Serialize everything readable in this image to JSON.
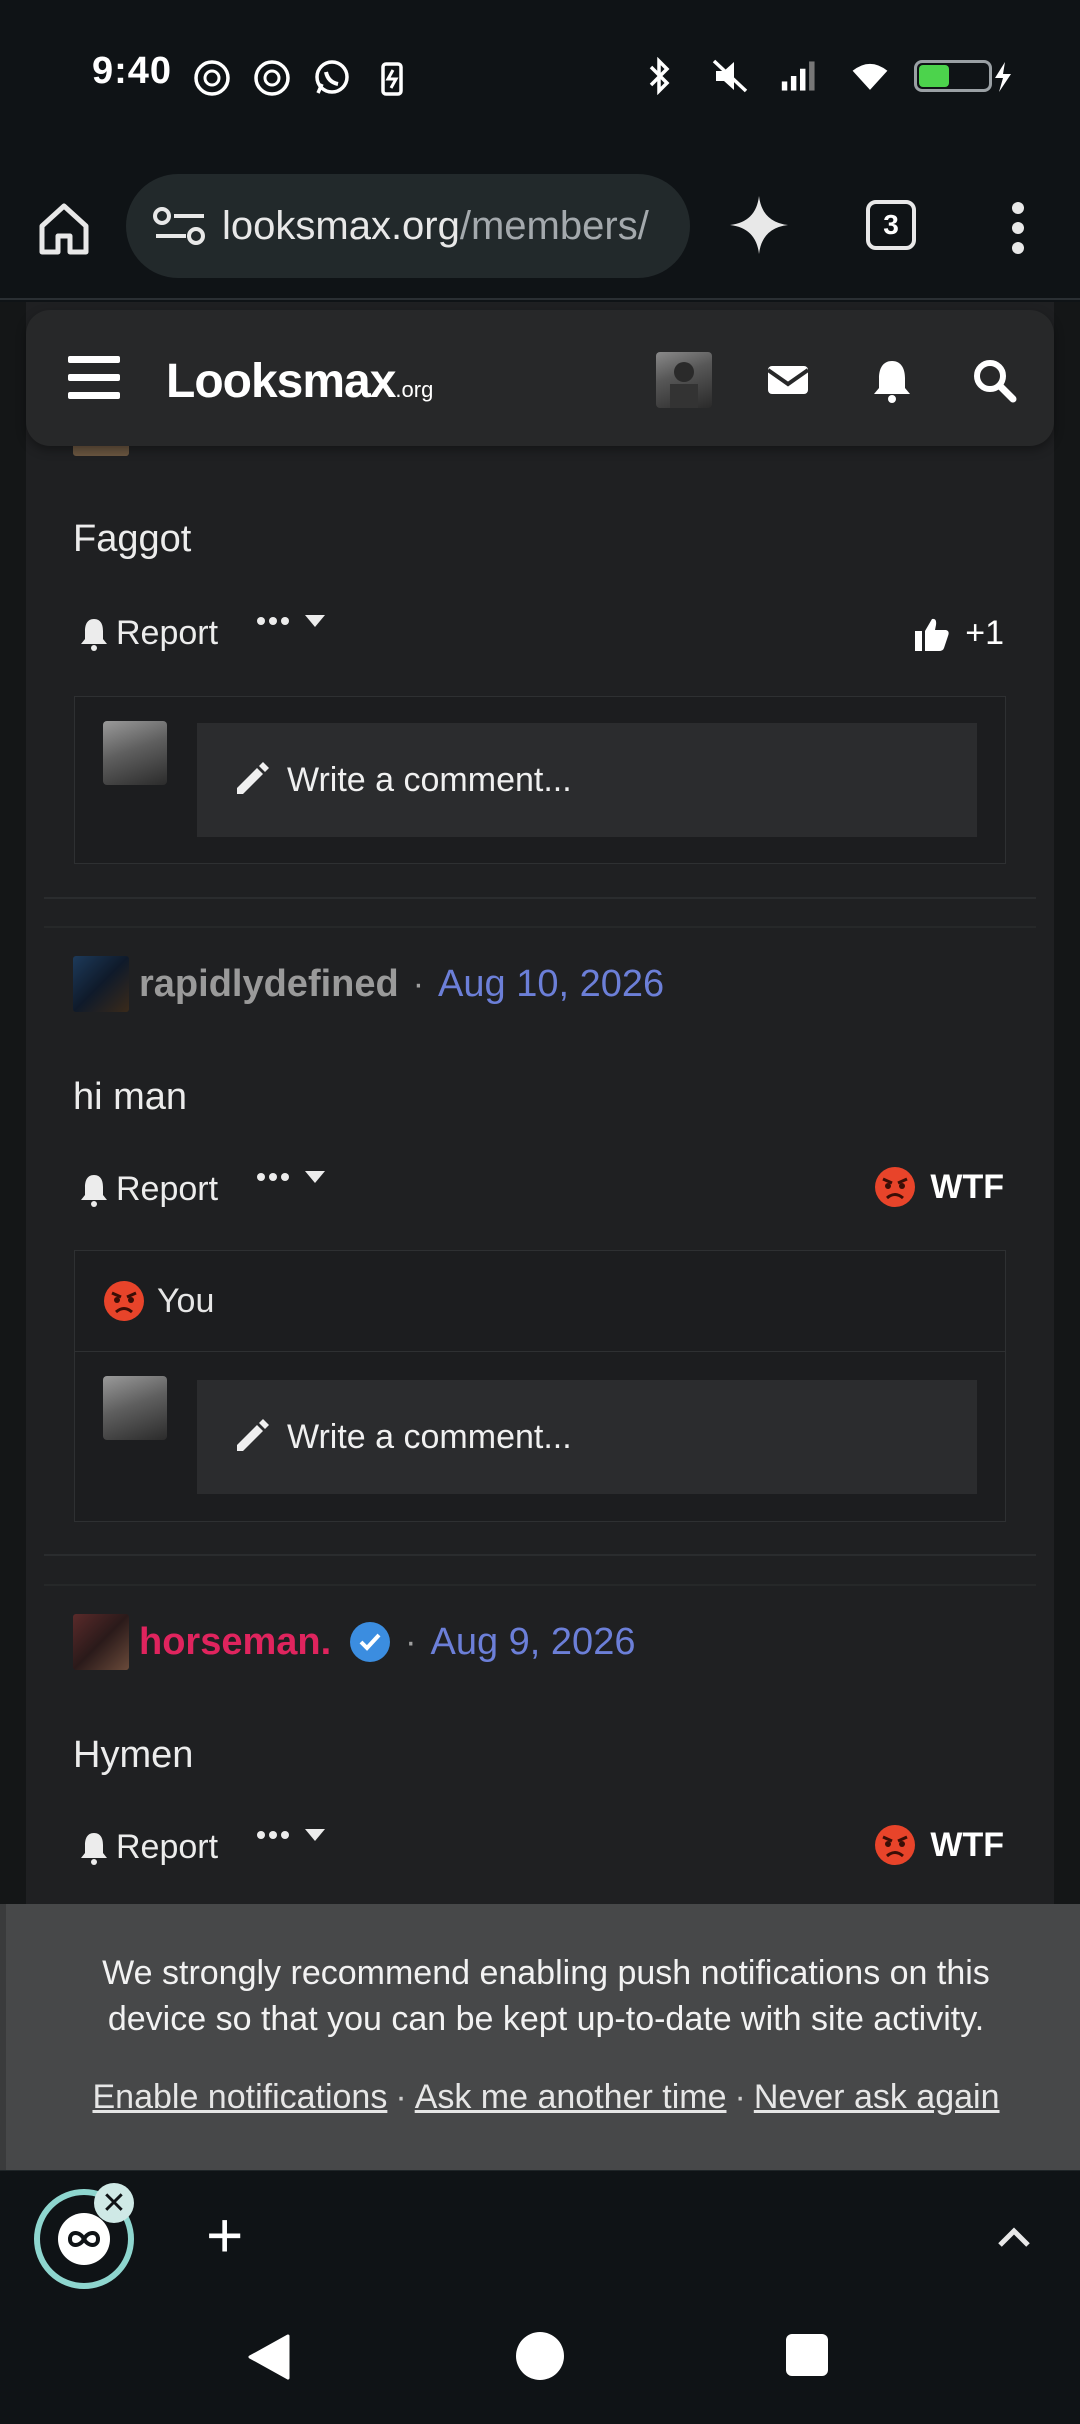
{
  "status_bar": {
    "time": "9:40"
  },
  "browser": {
    "url_host": "looksmax.org",
    "url_path": "/members/",
    "tab_count": "3"
  },
  "site": {
    "logo_main": "Looksmax",
    "logo_suffix": ".org"
  },
  "posts": [
    {
      "text": "Faggot",
      "report_label": "Report",
      "reaction_label": "+1",
      "comment_placeholder": "Write a comment..."
    },
    {
      "author": "rapidlydefined",
      "author_color": "#9a9a9a",
      "separator": "·",
      "date": "Aug 10, 2026",
      "text": "hi man",
      "report_label": "Report",
      "reaction_label": "WTF",
      "reacted_by": "You",
      "comment_placeholder": "Write a comment..."
    },
    {
      "author": "horseman.",
      "author_color": "#e0245e",
      "separator": "·",
      "date": "Aug 9, 2026",
      "text": "Hymen",
      "report_label": "Report",
      "reaction_label": "WTF"
    }
  ],
  "notification_banner": {
    "text": "We strongly recommend enabling push notifications on this device so that you can be kept up-to-date with site activity.",
    "link_enable": "Enable notifications",
    "link_later": "Ask me another time",
    "link_never": "Never ask again",
    "separator": "·"
  },
  "colors": {
    "date_link": "#6c7fd8",
    "verified_badge": "#3b8de0",
    "wtf_emoji": "#e8442a"
  }
}
